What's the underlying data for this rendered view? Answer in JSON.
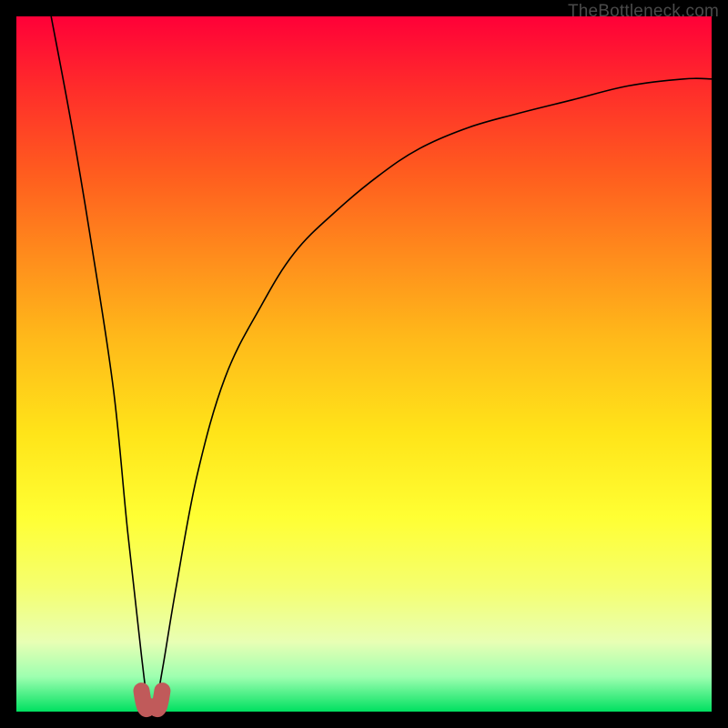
{
  "watermark": "TheBottleneck.com",
  "chart_data": {
    "type": "line",
    "title": "",
    "xlabel": "",
    "ylabel": "",
    "xlim": [
      0,
      100
    ],
    "ylim": [
      0,
      100
    ],
    "grid": false,
    "legend": false,
    "annotations": [],
    "description": "Bottleneck curve reaching minimum near x≈19; color gradient from red (top, high bottleneck) to green (bottom, low bottleneck).",
    "series": [
      {
        "name": "bottleneck-curve",
        "x_comment": "approximate normalized x positions across the plot (0=left,100=right)",
        "y_comment": "approximate bottleneck percentage / height (0=bottom green,100=top red)",
        "x": [
          5,
          8,
          11,
          14,
          16,
          18,
          19,
          20,
          21,
          23,
          26,
          30,
          35,
          40,
          46,
          52,
          58,
          65,
          72,
          80,
          88,
          96,
          100
        ],
        "y": [
          100,
          84,
          66,
          46,
          26,
          8,
          1,
          1,
          6,
          18,
          34,
          48,
          58,
          66,
          72,
          77,
          81,
          84,
          86,
          88,
          90,
          91,
          91
        ]
      },
      {
        "name": "optimal-zone-marker",
        "x": [
          18,
          19,
          20,
          21
        ],
        "y": [
          3,
          1,
          1,
          3
        ]
      }
    ],
    "colors": {
      "gradient_top": "#ff0038",
      "gradient_bottom": "#00e060",
      "curve": "#000000",
      "marker": "#c05a5a"
    }
  }
}
